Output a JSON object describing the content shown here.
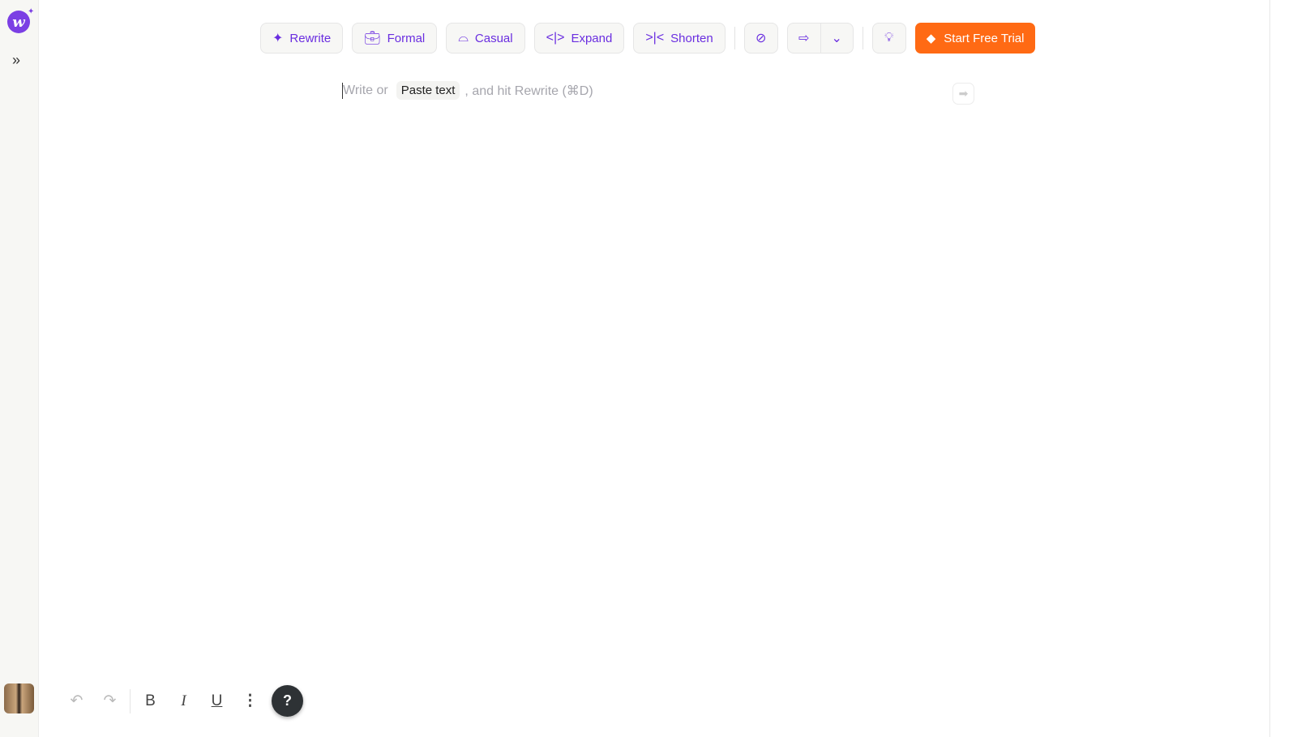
{
  "sidebar": {
    "logo": "w",
    "expand_icon": "chevrons-right-icon"
  },
  "toolbar": {
    "buttons": [
      {
        "label": "Rewrite",
        "icon": "sparkles-icon"
      },
      {
        "label": "Formal",
        "icon": "briefcase-icon"
      },
      {
        "label": "Casual",
        "icon": "sneaker-icon"
      },
      {
        "label": "Expand",
        "icon": "expand-icon"
      },
      {
        "label": "Shorten",
        "icon": "shorten-icon"
      }
    ],
    "trial_label": "Start Free Trial"
  },
  "editor": {
    "placeholder_before": "Write or",
    "paste_label": "Paste text",
    "placeholder_after": ", and hit Rewrite (⌘D)"
  },
  "bottom": {
    "help": "?"
  },
  "colors": {
    "accent": "#6a2ee0",
    "trial": "#ff6a14"
  }
}
